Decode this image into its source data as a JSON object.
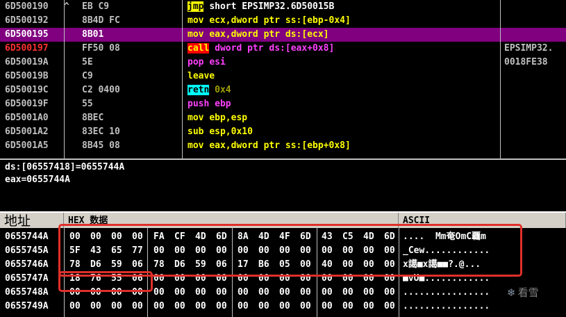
{
  "disassembly": {
    "rows": [
      {
        "addr": "6D500190",
        "mark": "^",
        "hex": "EB C9",
        "mnemonic": "jmp",
        "operands": "short EPSIMP32.6D50015B",
        "comment": "",
        "style": "jmp"
      },
      {
        "addr": "6D500192",
        "mark": "",
        "hex": "8B4D FC",
        "mnemonic": "mov",
        "operands": "ecx,dword ptr ss:[ebp-0x4]",
        "comment": "",
        "style": "mov"
      },
      {
        "addr": "6D500195",
        "mark": "",
        "hex": "8B01",
        "mnemonic": "mov",
        "operands": "eax,dword ptr ds:[ecx]",
        "comment": "",
        "style": "mov-sel"
      },
      {
        "addr": "6D500197",
        "mark": "",
        "hex": "FF50 08",
        "mnemonic": "call",
        "operands": "dword ptr ds:[eax+0x8]",
        "comment": "EPSIMP32.",
        "style": "call"
      },
      {
        "addr": "6D50019A",
        "mark": "",
        "hex": "5E",
        "mnemonic": "pop",
        "operands": "esi",
        "comment": "0018FE38",
        "style": "pop"
      },
      {
        "addr": "6D50019B",
        "mark": "",
        "hex": "C9",
        "mnemonic": "leave",
        "operands": "",
        "comment": "",
        "style": "plain"
      },
      {
        "addr": "6D50019C",
        "mark": "",
        "hex": "C2 0400",
        "mnemonic": "retn",
        "operands": "0x4",
        "comment": "",
        "style": "retn"
      },
      {
        "addr": "6D50019F",
        "mark": "",
        "hex": "55",
        "mnemonic": "push",
        "operands": "ebp",
        "comment": "",
        "style": "push"
      },
      {
        "addr": "6D5001A0",
        "mark": "",
        "hex": "8BEC",
        "mnemonic": "mov",
        "operands": "ebp,esp",
        "comment": "",
        "style": "mov"
      },
      {
        "addr": "6D5001A2",
        "mark": "",
        "hex": "83EC 10",
        "mnemonic": "sub",
        "operands": "esp,0x10",
        "comment": "",
        "style": "sub"
      },
      {
        "addr": "6D5001A5",
        "mark": "",
        "hex": "8B45 08",
        "mnemonic": "mov",
        "operands": "eax,dword ptr ss:[ebp+0x8]",
        "comment": "",
        "style": "mov"
      }
    ],
    "selected_index": 2,
    "current_eip_index": 3
  },
  "info": {
    "line1": "ds:[06557418]=0655744A",
    "line2": "eax=0655744A"
  },
  "dump": {
    "headers": {
      "address": "地址",
      "hex": "HEX 数据",
      "ascii": "ASCII"
    },
    "rows": [
      {
        "addr": "0655744A",
        "bytes": [
          "00",
          "00",
          "00",
          "00",
          "FA",
          "CF",
          "4D",
          "6D",
          "8A",
          "4D",
          "4F",
          "6D",
          "43",
          "C5",
          "4D",
          "6D"
        ],
        "ascii": "....  Mm奄OmC覊m"
      },
      {
        "addr": "0655745A",
        "bytes": [
          "5F",
          "43",
          "65",
          "77",
          "00",
          "00",
          "00",
          "00",
          "00",
          "00",
          "00",
          "00",
          "00",
          "00",
          "00",
          "00"
        ],
        "ascii": "_Cew............"
      },
      {
        "addr": "0655746A",
        "bytes": [
          "78",
          "D6",
          "59",
          "06",
          "78",
          "D6",
          "59",
          "06",
          "17",
          "B6",
          "05",
          "00",
          "40",
          "00",
          "00",
          "00"
        ],
        "ascii": "x譪■x譪■■?.@..."
      },
      {
        "addr": "0655747A",
        "bytes": [
          "18",
          "76",
          "55",
          "06",
          "00",
          "00",
          "00",
          "00",
          "00",
          "00",
          "00",
          "00",
          "00",
          "00",
          "00",
          "00"
        ],
        "ascii": "■vU■............"
      },
      {
        "addr": "0655748A",
        "bytes": [
          "00",
          "00",
          "00",
          "00",
          "00",
          "00",
          "00",
          "00",
          "00",
          "00",
          "00",
          "00",
          "00",
          "00",
          "00",
          "00"
        ],
        "ascii": "................"
      },
      {
        "addr": "0655749A",
        "bytes": [
          "00",
          "00",
          "00",
          "00",
          "00",
          "00",
          "00",
          "00",
          "00",
          "00",
          "00",
          "00",
          "00",
          "00",
          "00",
          "00"
        ],
        "ascii": "................"
      }
    ]
  },
  "watermark": {
    "text": "看雪",
    "icon": "snowflake-icon"
  },
  "colors": {
    "selection": "#800080",
    "highlight_box": "#e0302a",
    "header_bg": "#d4d0c8"
  }
}
